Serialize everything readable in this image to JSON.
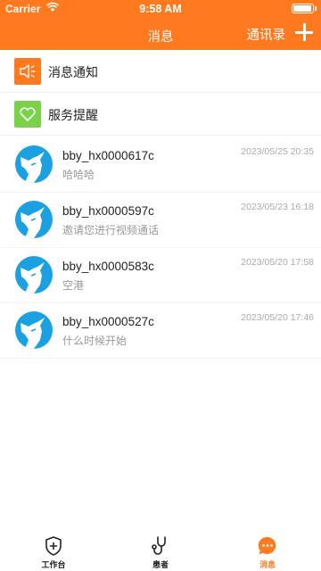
{
  "status": {
    "carrier": "Carrier",
    "time": "9:58 AM"
  },
  "header": {
    "title": "消息",
    "contacts_label": "通讯录"
  },
  "system": [
    {
      "label": "消息通知",
      "icon": "speaker-icon",
      "color": "#FF7A1F"
    },
    {
      "label": "服务提醒",
      "icon": "heart-icon",
      "color": "#7BD14A"
    }
  ],
  "chats": [
    {
      "name": "bby_hx0000617c",
      "message": "哈哈哈",
      "time": "2023/05/25 20:35"
    },
    {
      "name": "bby_hx0000597c",
      "message": "邀请您进行视频通话",
      "time": "2023/05/23 16:18"
    },
    {
      "name": "bby_hx0000583c",
      "message": "空港",
      "time": "2023/05/20 17:58"
    },
    {
      "name": "bby_hx0000527c",
      "message": "什么时候开始",
      "time": "2023/05/20 17:46"
    }
  ],
  "tabs": [
    {
      "label": "工作台",
      "icon": "shield-plus-icon"
    },
    {
      "label": "患者",
      "icon": "stethoscope-icon"
    },
    {
      "label": "消息",
      "icon": "chat-bubble-icon"
    }
  ],
  "colors": {
    "accent": "#FF7A1F",
    "avatar": "#1BA1E2",
    "service_green": "#7BD14A"
  }
}
